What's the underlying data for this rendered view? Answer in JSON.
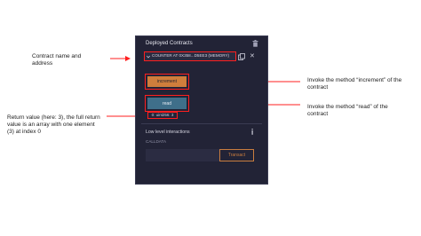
{
  "annotations": {
    "contract_name": "Contract name and address",
    "increment": "Invoke the method “increment” of the contract",
    "read": "Invoke the method “read” of the contract",
    "return_value": "Return value (here: 3), the full return value is an array with one element (3) at index 0"
  },
  "panel": {
    "title": "Deployed Contracts",
    "instance": "COUNTER AT 0X358...D5EE3 (MEMORY)",
    "buttons": {
      "increment": "increment",
      "read": "read"
    },
    "return_value": "0: uint256: 3",
    "low_level": {
      "title": "Low level interactions",
      "calldata_label": "CALLDATA",
      "calldata_value": "",
      "transact": "Transact"
    }
  },
  "colors": {
    "panel_bg": "#222336",
    "highlight": "#ff1f1f",
    "increment_btn": "#cf7e3c",
    "read_btn": "#3f6f8a"
  },
  "icons": {
    "trash": "trash-icon",
    "copy": "copy-icon",
    "close": "close-icon",
    "chevron": "chevron-down-icon",
    "info": "info-icon"
  }
}
